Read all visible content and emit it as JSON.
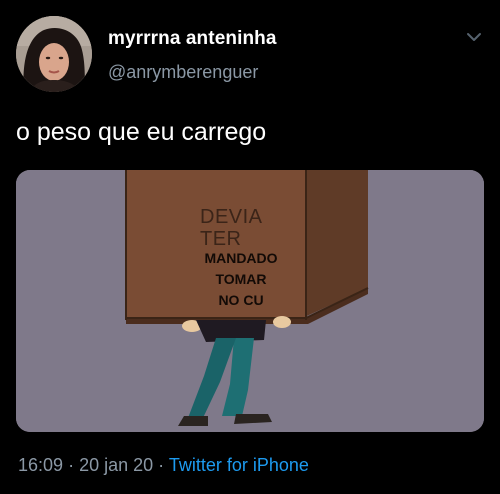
{
  "tweet": {
    "display_name": "myrrrna anteninha",
    "handle": "@anrymberenguer",
    "text": "o peso que eu carrego",
    "menu_icon": "chevron-down-icon",
    "avatar_icon": "user-avatar",
    "media": {
      "box_text_line1": "DEVIA",
      "box_text_line2": "TER",
      "box_text_line3": "MANDADO",
      "box_text_line4": "TOMAR",
      "box_text_line5": "NO CU"
    },
    "meta": {
      "time": "16:09",
      "separator1": "·",
      "date": "20 jan 20",
      "separator2": "·",
      "source": "Twitter for iPhone"
    }
  },
  "colors": {
    "background": "#000000",
    "name": "#ffffff",
    "secondary": "#8b98a5",
    "link": "#1d9bf0"
  }
}
